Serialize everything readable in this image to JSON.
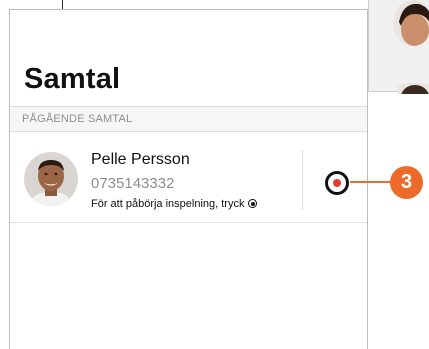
{
  "screen": {
    "title": "Samtal",
    "section_header": "PÅGÅENDE SAMTAL"
  },
  "call": {
    "name": "Pelle Persson",
    "number": "0735143332",
    "hint": "För att påbörja inspelning, tryck"
  },
  "callout": {
    "number": "3",
    "color": "#ec6a2a"
  },
  "colors": {
    "record_dot": "#e53b2c",
    "secondary_text": "#8e8e93"
  },
  "icons": {
    "record": "record-icon",
    "avatar": "avatar"
  }
}
